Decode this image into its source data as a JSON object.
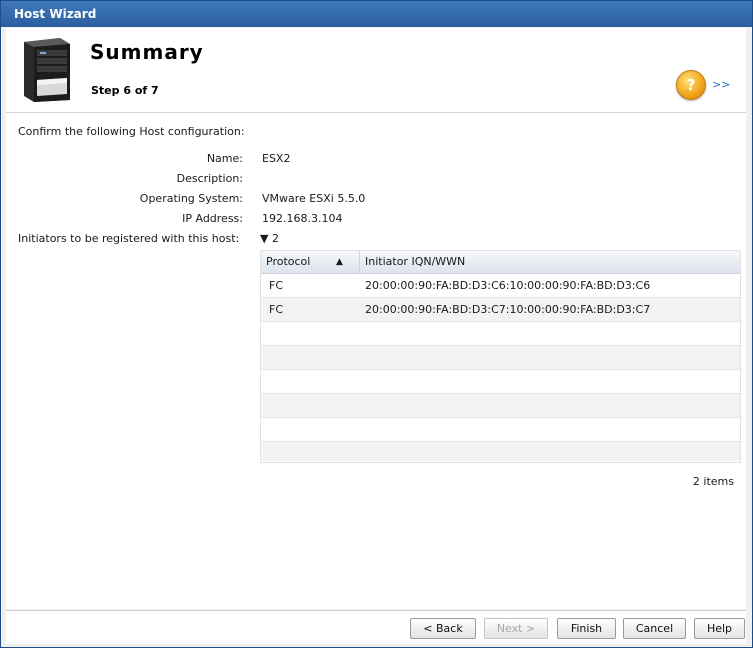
{
  "window": {
    "title": "Host Wizard"
  },
  "header": {
    "title": "Summary",
    "step": "Step 6 of 7",
    "icon": "server-tower-icon",
    "help_icon": "help-icon",
    "next_arrow": ">>"
  },
  "summary": {
    "intro": "Confirm the following Host configuration:",
    "fields": [
      {
        "label": "Name:",
        "value": "ESX2"
      },
      {
        "label": "Description:",
        "value": ""
      },
      {
        "label": "Operating System:",
        "value": "VMware ESXi 5.5.0"
      },
      {
        "label": "IP Address:",
        "value": "192.168.3.104"
      },
      {
        "label": "Initiators to be registered with this host:",
        "value": "▼ 2"
      }
    ]
  },
  "initiators": {
    "columns": [
      "Protocol",
      "Initiator IQN/WWN"
    ],
    "sort_indicator": "▲",
    "rows": [
      {
        "protocol": "FC",
        "iqn": "20:00:00:90:FA:BD:D3:C6:10:00:00:90:FA:BD:D3:C6"
      },
      {
        "protocol": "FC",
        "iqn": "20:00:00:90:FA:BD:D3:C7:10:00:00:90:FA:BD:D3:C7"
      }
    ],
    "item_count": "2 items"
  },
  "buttons": {
    "back": "< Back",
    "next": "Next >",
    "finish": "Finish",
    "cancel": "Cancel",
    "help": "Help"
  },
  "colors": {
    "titlebar": "#2a5e9e",
    "link": "#2a6fc4",
    "help_icon": "#f0a219"
  }
}
